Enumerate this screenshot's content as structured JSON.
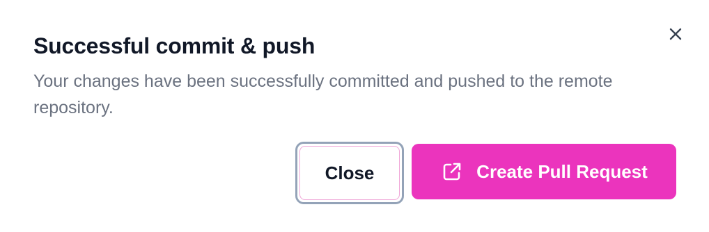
{
  "dialog": {
    "title": "Successful commit & push",
    "message": "Your changes have been successfully committed and pushed to the remote repository.",
    "close_icon": "close-x-icon",
    "buttons": {
      "close_label": "Close",
      "primary_label": "Create Pull Request",
      "primary_icon": "external-link-icon"
    },
    "colors": {
      "primary_bg": "#eb34bd",
      "title": "#111827",
      "message": "#6b7280",
      "focus_ring": "#94a3b8"
    }
  }
}
